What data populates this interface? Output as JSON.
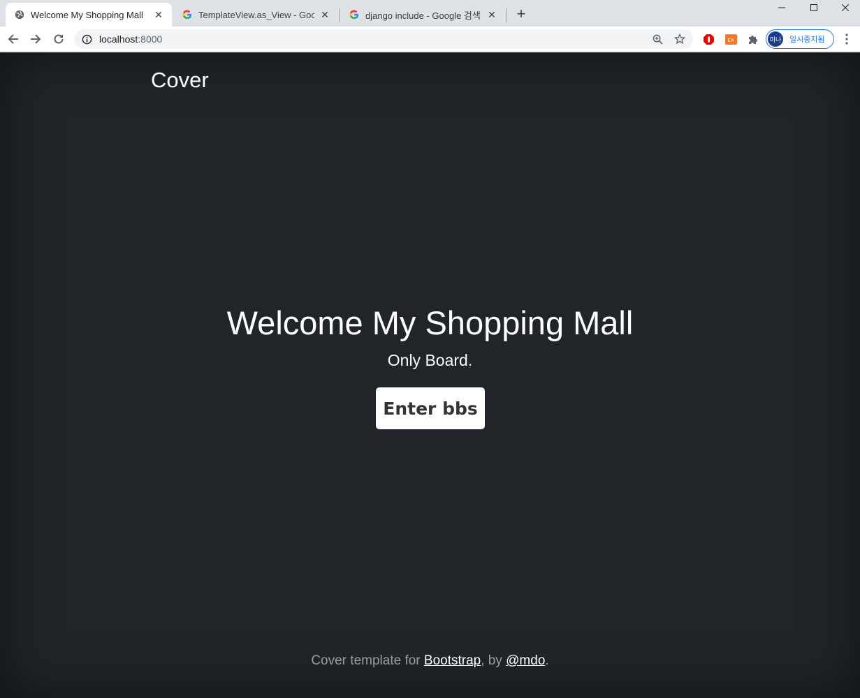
{
  "browser": {
    "tabs": [
      {
        "title": "Welcome My Shopping Mall",
        "favicon": "globe-icon",
        "active": true
      },
      {
        "title": "TemplateView.as_View - Google",
        "favicon": "google-icon",
        "active": false
      },
      {
        "title": "django include - Google 검색",
        "favicon": "google-icon",
        "active": false
      }
    ],
    "close_glyph": "✕",
    "new_tab_glyph": "+",
    "url_host": "localhost",
    "url_port": ":8000",
    "profile_avatar": "미나",
    "profile_label": "일시중지됨",
    "extensions": [
      "adblock-icon",
      "ex-extension-icon",
      "puzzle-icon"
    ]
  },
  "page": {
    "brand": "Cover",
    "title": "Welcome My Shopping Mall",
    "lead": "Only Board.",
    "button_label": "Enter bbs",
    "footer": {
      "prefix": "Cover template for ",
      "link1": "Bootstrap",
      "middle": ", by ",
      "link2": "@mdo",
      "suffix": "."
    }
  },
  "colors": {
    "page_bg": "#212529",
    "tabstrip_bg": "#dee1e6",
    "accent": "#1a73e8"
  }
}
